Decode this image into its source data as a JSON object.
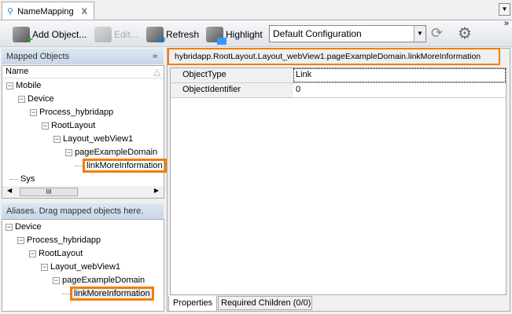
{
  "tab": {
    "title": "NameMapping",
    "close": "X",
    "icon": "map-pin-icon"
  },
  "toolbar": {
    "add": "Add Object...",
    "edit": "Edit...",
    "refresh": "Refresh",
    "highlight": "Highlight",
    "config": "Default Configuration",
    "more": "»"
  },
  "mapped": {
    "title": "Mapped Objects",
    "column": "Name",
    "items": [
      "Mobile",
      "Device",
      "Process_hybridapp",
      "RootLayout",
      "Layout_webView1",
      "pageExampleDomain",
      "linkMoreInformation",
      "Sys"
    ]
  },
  "aliases": {
    "title": "Aliases. Drag mapped objects here.",
    "items": [
      "Device",
      "Process_hybridapp",
      "RootLayout",
      "Layout_webView1",
      "pageExampleDomain",
      "linkMoreInformation"
    ]
  },
  "path": "hybridapp.RootLayout.Layout_webView1.pageExampleDomain.linkMoreInformation",
  "properties": [
    {
      "name": "ObjectType",
      "value": "Link"
    },
    {
      "name": "ObjectIdentifier",
      "value": "0"
    }
  ],
  "bottom_tabs": [
    "Properties",
    "Required Children (0/0)"
  ],
  "colors": {
    "highlight": "#f57c00"
  }
}
